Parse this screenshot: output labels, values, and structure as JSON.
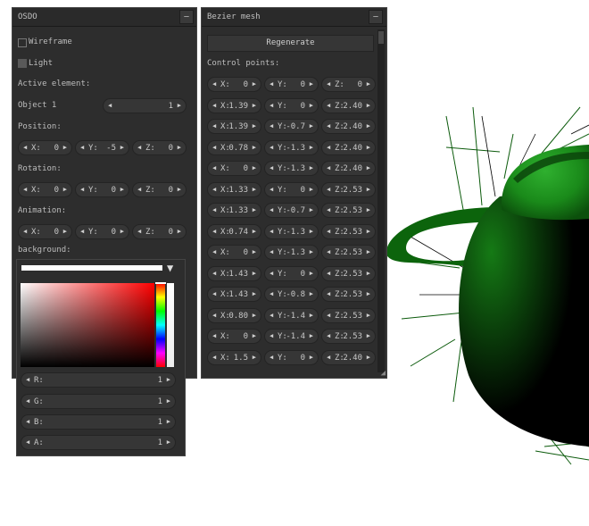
{
  "osdo": {
    "title": "OSDO",
    "min": "–",
    "wireframe": "Wireframe",
    "light": "Light",
    "active_element": "Active element:",
    "object_label": "Object 1",
    "object_value": "1",
    "position": "Position:",
    "rotation": "Rotation:",
    "animation": "Animation:",
    "background": "background:",
    "pos": [
      {
        "n": "X:",
        "v": "0"
      },
      {
        "n": "Y:",
        "v": "-5"
      },
      {
        "n": "Z:",
        "v": "0"
      }
    ],
    "rot": [
      {
        "n": "X:",
        "v": "0"
      },
      {
        "n": "Y:",
        "v": "0"
      },
      {
        "n": "Z:",
        "v": "0"
      }
    ],
    "anim": [
      {
        "n": "X:",
        "v": "0"
      },
      {
        "n": "Y:",
        "v": "0"
      },
      {
        "n": "Z:",
        "v": "0"
      }
    ],
    "rgba": [
      {
        "n": "R:",
        "v": "1"
      },
      {
        "n": "G:",
        "v": "1"
      },
      {
        "n": "B:",
        "v": "1"
      },
      {
        "n": "A:",
        "v": "1"
      }
    ]
  },
  "bezier": {
    "title": "Bezier mesh",
    "min": "–",
    "regenerate": "Regenerate",
    "control_points": "Control points:",
    "rows": [
      [
        {
          "n": "X:",
          "v": "0"
        },
        {
          "n": "Y:",
          "v": "0"
        },
        {
          "n": "Z:",
          "v": "0"
        }
      ],
      [
        {
          "n": "X:",
          "v": "1.39"
        },
        {
          "n": "Y:",
          "v": "0"
        },
        {
          "n": "Z:",
          "v": "2.40"
        }
      ],
      [
        {
          "n": "X:",
          "v": "1.39"
        },
        {
          "n": "Y:",
          "v": "-0.7"
        },
        {
          "n": "Z:",
          "v": "2.40"
        }
      ],
      [
        {
          "n": "X:",
          "v": "0.78"
        },
        {
          "n": "Y:",
          "v": "-1.3"
        },
        {
          "n": "Z:",
          "v": "2.40"
        }
      ],
      [
        {
          "n": "X:",
          "v": "0"
        },
        {
          "n": "Y:",
          "v": "-1.3"
        },
        {
          "n": "Z:",
          "v": "2.40"
        }
      ],
      [
        {
          "n": "X:",
          "v": "1.33"
        },
        {
          "n": "Y:",
          "v": "0"
        },
        {
          "n": "Z:",
          "v": "2.53"
        }
      ],
      [
        {
          "n": "X:",
          "v": "1.33"
        },
        {
          "n": "Y:",
          "v": "-0.7"
        },
        {
          "n": "Z:",
          "v": "2.53"
        }
      ],
      [
        {
          "n": "X:",
          "v": "0.74"
        },
        {
          "n": "Y:",
          "v": "-1.3"
        },
        {
          "n": "Z:",
          "v": "2.53"
        }
      ],
      [
        {
          "n": "X:",
          "v": "0"
        },
        {
          "n": "Y:",
          "v": "-1.3"
        },
        {
          "n": "Z:",
          "v": "2.53"
        }
      ],
      [
        {
          "n": "X:",
          "v": "1.43"
        },
        {
          "n": "Y:",
          "v": "0"
        },
        {
          "n": "Z:",
          "v": "2.53"
        }
      ],
      [
        {
          "n": "X:",
          "v": "1.43"
        },
        {
          "n": "Y:",
          "v": "-0.8"
        },
        {
          "n": "Z:",
          "v": "2.53"
        }
      ],
      [
        {
          "n": "X:",
          "v": "0.80"
        },
        {
          "n": "Y:",
          "v": "-1.4"
        },
        {
          "n": "Z:",
          "v": "2.53"
        }
      ],
      [
        {
          "n": "X:",
          "v": "0"
        },
        {
          "n": "Y:",
          "v": "-1.4"
        },
        {
          "n": "Z:",
          "v": "2.53"
        }
      ],
      [
        {
          "n": "X:",
          "v": "1.5"
        },
        {
          "n": "Y:",
          "v": "0"
        },
        {
          "n": "Z:",
          "v": "2.40"
        }
      ]
    ]
  },
  "icons": {
    "left": "◀",
    "right": "▶",
    "dropdown": "▼",
    "resize": "◢"
  },
  "colors": {
    "panel": "#2d2d2d",
    "mesh_green": "#1f8f1f",
    "hue_bar": "rainbow"
  }
}
